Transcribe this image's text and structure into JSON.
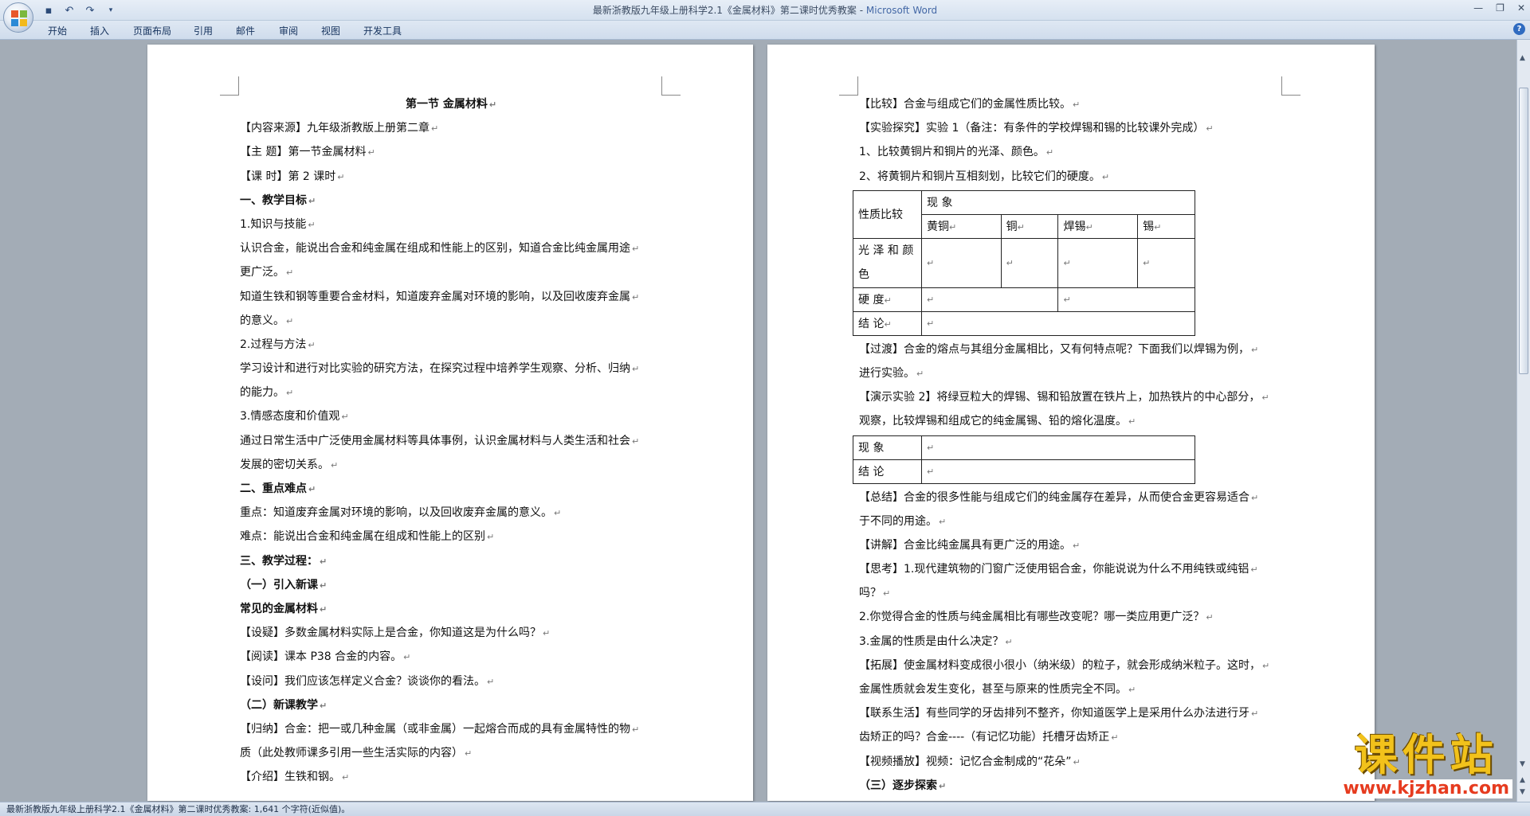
{
  "window": {
    "title_doc": "最新浙教版九年级上册科学2.1《金属材料》第二课时优秀教案",
    "title_app": "Microsoft Word"
  },
  "ribbon": {
    "tabs": [
      "开始",
      "插入",
      "页面布局",
      "引用",
      "邮件",
      "审阅",
      "视图",
      "开发工具"
    ]
  },
  "page1": {
    "lines": [
      "第一节    金属材料",
      "【内容来源】九年级浙教版上册第二章",
      "【主      题】第一节金属材料",
      "【课      时】第 2 课时",
      "一、教学目标",
      "1.知识与技能",
      "认识合金，能说出合金和纯金属在组成和性能上的区别，知道合金比纯金属用途",
      "更广泛。",
      "知道生铁和钢等重要合金材料，知道废弃金属对环境的影响，以及回收废弃金属",
      "的意义。",
      "2.过程与方法",
      "学习设计和进行对比实验的研究方法，在探究过程中培养学生观察、分析、归纳",
      "的能力。",
      "3.情感态度和价值观",
      "通过日常生活中广泛使用金属材料等具体事例，认识金属材料与人类生活和社会",
      "发展的密切关系。",
      "二、重点难点",
      "重点：知道废弃金属对环境的影响，以及回收废弃金属的意义。",
      "难点：能说出合金和纯金属在组成和性能上的区别",
      "三、教学过程：",
      "（一）引入新课",
      "常见的金属材料",
      "【设疑】多数金属材料实际上是合金，你知道这是为什么吗？",
      "【阅读】课本 P38 合金的内容。",
      "【设问】我们应该怎样定义合金？谈谈你的看法。",
      "（二）新课教学",
      "【归纳】合金：把一或几种金属（或非金属）一起熔合而成的具有金属特性的物",
      "质（此处教师课多引用一些生活实际的内容）",
      "【介绍】生铁和钢。"
    ]
  },
  "page2": {
    "intro": [
      "【比较】合金与组成它们的金属性质比较。",
      "【实验探究】实验 1（备注：有条件的学校焊锡和锡的比较课外完成）",
      "1、比较黄铜片和铜片的光泽、颜色。",
      "2、将黄铜片和铜片互相刻划，比较它们的硬度。"
    ],
    "table1": {
      "header_prop": "性质比较",
      "header_phen": "现  象",
      "cols": [
        "黄铜",
        "铜",
        "焊锡",
        "锡"
      ],
      "row_luster": "光 泽 和 颜 色",
      "row_hardness": "硬  度",
      "row_conclusion": "结  论"
    },
    "mid": [
      "【过渡】合金的熔点与其组分金属相比，又有何特点呢？下面我们以焊锡为例，",
      "进行实验。",
      "【演示实验 2】将绿豆粒大的焊锡、锡和铅放置在铁片上，加热铁片的中心部分，",
      "观察，比较焊锡和组成它的纯金属锡、铅的熔化温度。"
    ],
    "table2": {
      "row_phen": "现  象",
      "row_conclusion": "结  论"
    },
    "tail": [
      "【总结】合金的很多性能与组成它们的纯金属存在差异，从而使合金更容易适合",
      "于不同的用途。",
      "【讲解】合金比纯金属具有更广泛的用途。",
      "【思考】1.现代建筑物的门窗广泛使用铝合金，你能说说为什么不用纯铁或纯铝",
      "吗？",
      "2.你觉得合金的性质与纯金属相比有哪些改变呢？哪一类应用更广泛？",
      "3.金属的性质是由什么决定？",
      "【拓展】使金属材料变成很小很小（纳米级）的粒子，就会形成纳米粒子。这时，",
      "金属性质就会发生变化，甚至与原来的性质完全不同。",
      "【联系生活】有些同学的牙齿排列不整齐，你知道医学上是采用什么办法进行牙",
      "齿矫正的吗？合金----（有记忆功能）托槽牙齿矫正",
      "【视频播放】视频：记忆合金制成的“花朵”",
      "（三）逐步探索"
    ]
  },
  "statusbar": {
    "text": "最新浙教版九年级上册科学2.1《金属材料》第二课时优秀教案: 1,641 个字符(近似值)。"
  },
  "watermark": {
    "title": "课件站",
    "url": "www.kjzhan.com"
  },
  "icons": {
    "office_button": "office-logo-icon",
    "save": "save-icon",
    "undo": "undo-icon",
    "redo": "redo-icon",
    "help": "help-icon"
  }
}
